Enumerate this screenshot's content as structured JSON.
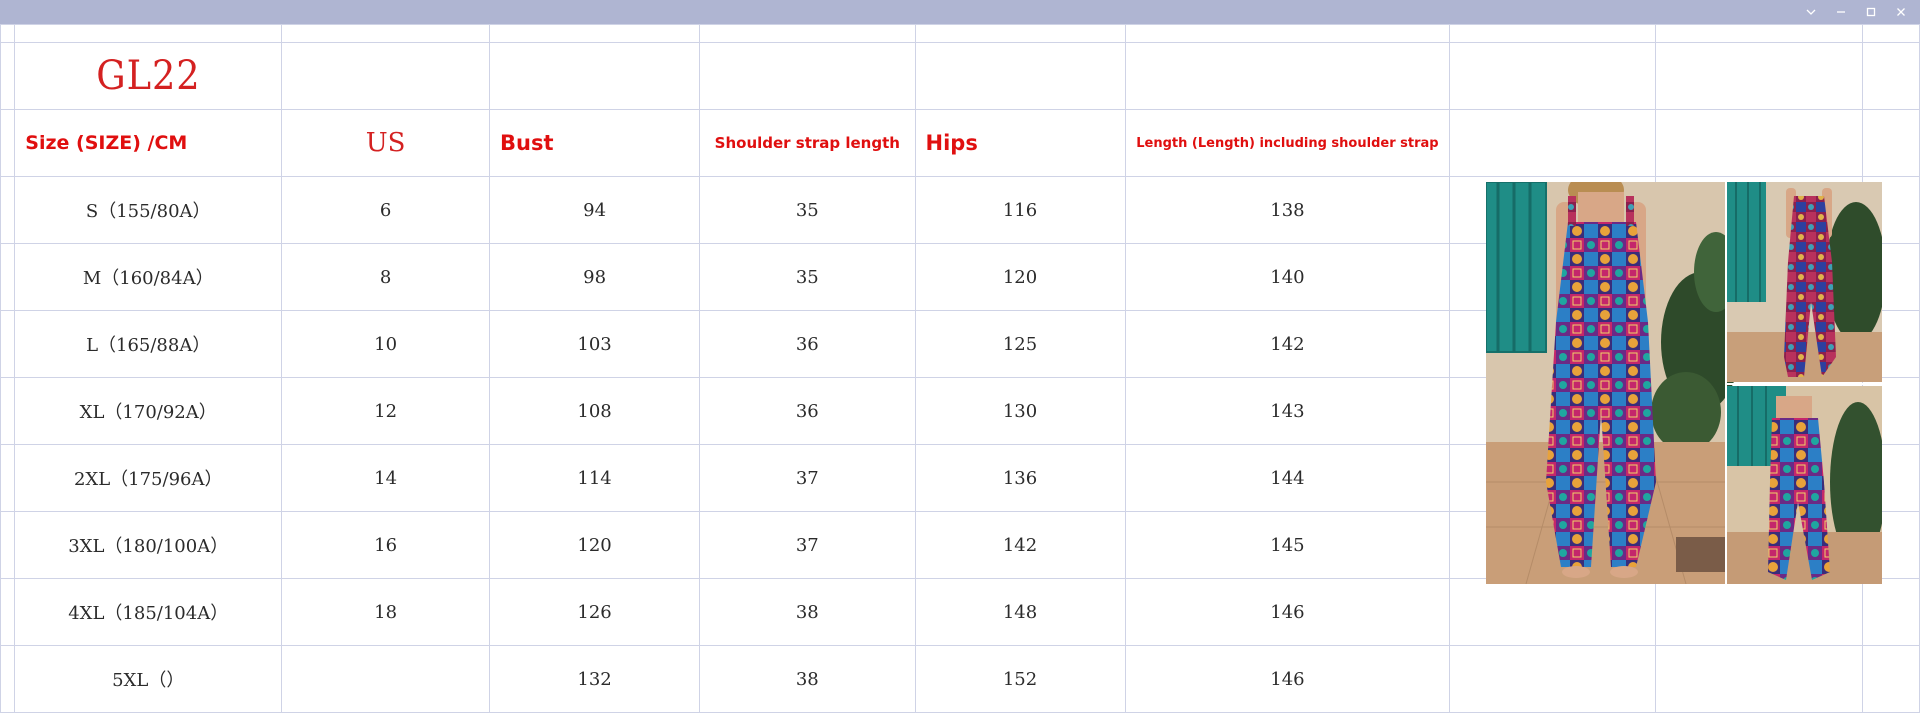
{
  "brand_code": "GL22",
  "headers": {
    "size": "Size (SIZE) /CM",
    "us": "US",
    "bust": "Bust",
    "shoulder": "Shoulder strap length",
    "hips": "Hips",
    "length": "Length (Length) including shoulder strap"
  },
  "rows": [
    {
      "size": "S（155/80A）",
      "us": "6",
      "bust": "94",
      "shoulder": "35",
      "hips": "116",
      "length": "138"
    },
    {
      "size": "M（160/84A）",
      "us": "8",
      "bust": "98",
      "shoulder": "35",
      "hips": "120",
      "length": "140"
    },
    {
      "size": "L（165/88A）",
      "us": "10",
      "bust": "103",
      "shoulder": "36",
      "hips": "125",
      "length": "142"
    },
    {
      "size": "XL（170/92A）",
      "us": "12",
      "bust": "108",
      "shoulder": "36",
      "hips": "130",
      "length": "143"
    },
    {
      "size": "2XL（175/96A）",
      "us": "14",
      "bust": "114",
      "shoulder": "37",
      "hips": "136",
      "length": "144"
    },
    {
      "size": "3XL（180/100A）",
      "us": "16",
      "bust": "120",
      "shoulder": "37",
      "hips": "142",
      "length": "145"
    },
    {
      "size": "4XL（185/104A）",
      "us": "18",
      "bust": "126",
      "shoulder": "38",
      "hips": "148",
      "length": "146"
    },
    {
      "size": "5XL（）",
      "us": "",
      "bust": "132",
      "shoulder": "38",
      "hips": "152",
      "length": "146"
    }
  ],
  "window_controls": {
    "icons": [
      "chevron-down-icon",
      "minimize-icon",
      "maximize-icon",
      "close-icon"
    ]
  },
  "colors": {
    "titlebar": "#afb5d2",
    "header_red": "#e00f0f",
    "gridline": "#cfd3e6"
  }
}
